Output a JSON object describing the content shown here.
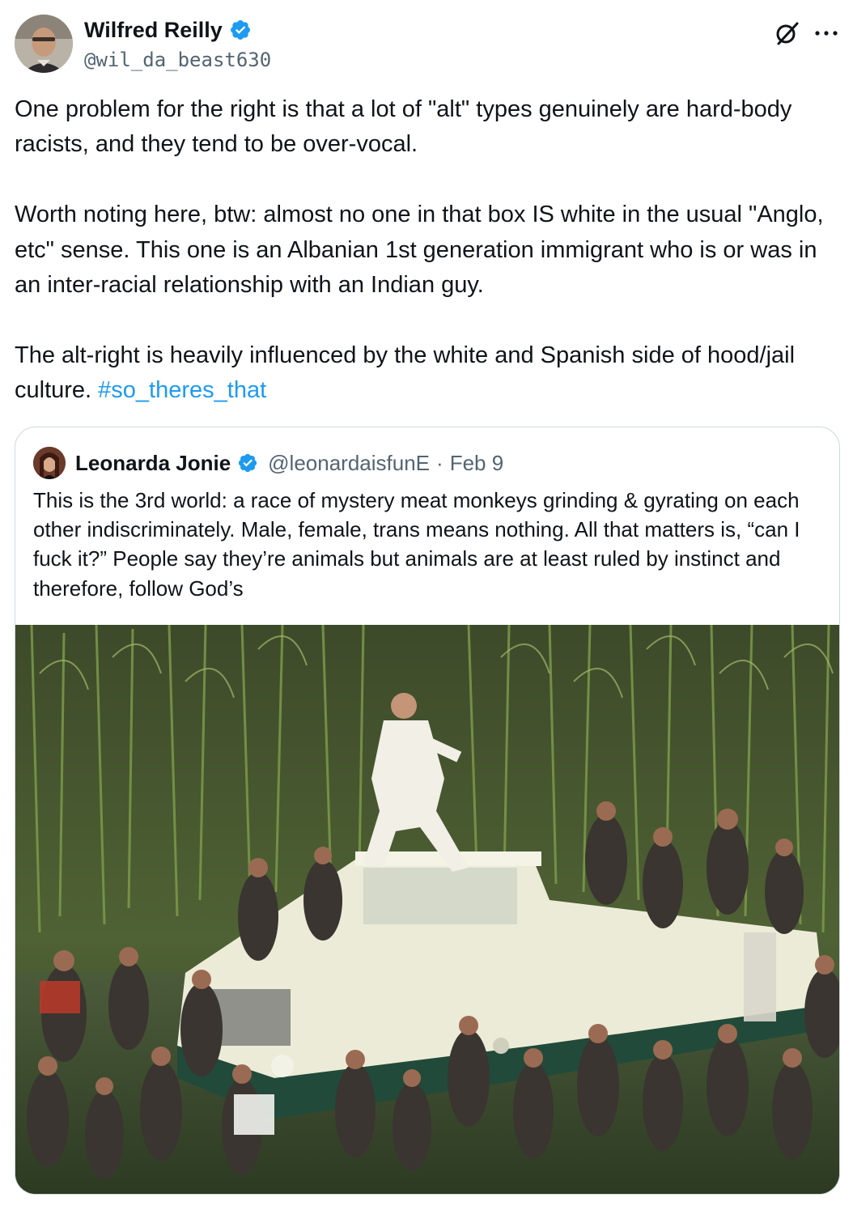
{
  "author": {
    "name": "Wilfred Reilly",
    "handle": "@wil_da_beast630"
  },
  "icons": {
    "verified": "verified-badge-icon",
    "grok": "grok-icon",
    "more": "more-icon"
  },
  "colors": {
    "link": "#1d9bf0",
    "verified": "#1d9bf0",
    "secondary_text": "#536471",
    "border": "#cfd9de"
  },
  "tweet": {
    "paragraph1": "One problem for the right is that a lot of \"alt\" types genuinely are hard-body racists, and they tend to be over-vocal.",
    "paragraph2": "Worth noting here, btw: almost no one in that box IS white in the usual \"Anglo, etc\" sense. This one is an Albanian 1st generation immigrant who is or was in an inter-racial relationship with an Indian guy.",
    "paragraph3": "The alt-right is heavily influenced by the white and Spanish side of hood/jail culture.",
    "hashtag": "#so_theres_that"
  },
  "quote": {
    "name": "Leonarda Jonie",
    "handle": "@leonardaisfunE",
    "separator": "·",
    "date": "Feb 9",
    "text": "This is the 3rd world: a race of mystery meat monkeys grinding & gyrating on each other indiscriminately. Male, female, trans means nothing. All that matters is, “can I fuck it?” People say they’re animals but animals are at least ruled by instinct and therefore, follow God’s"
  }
}
